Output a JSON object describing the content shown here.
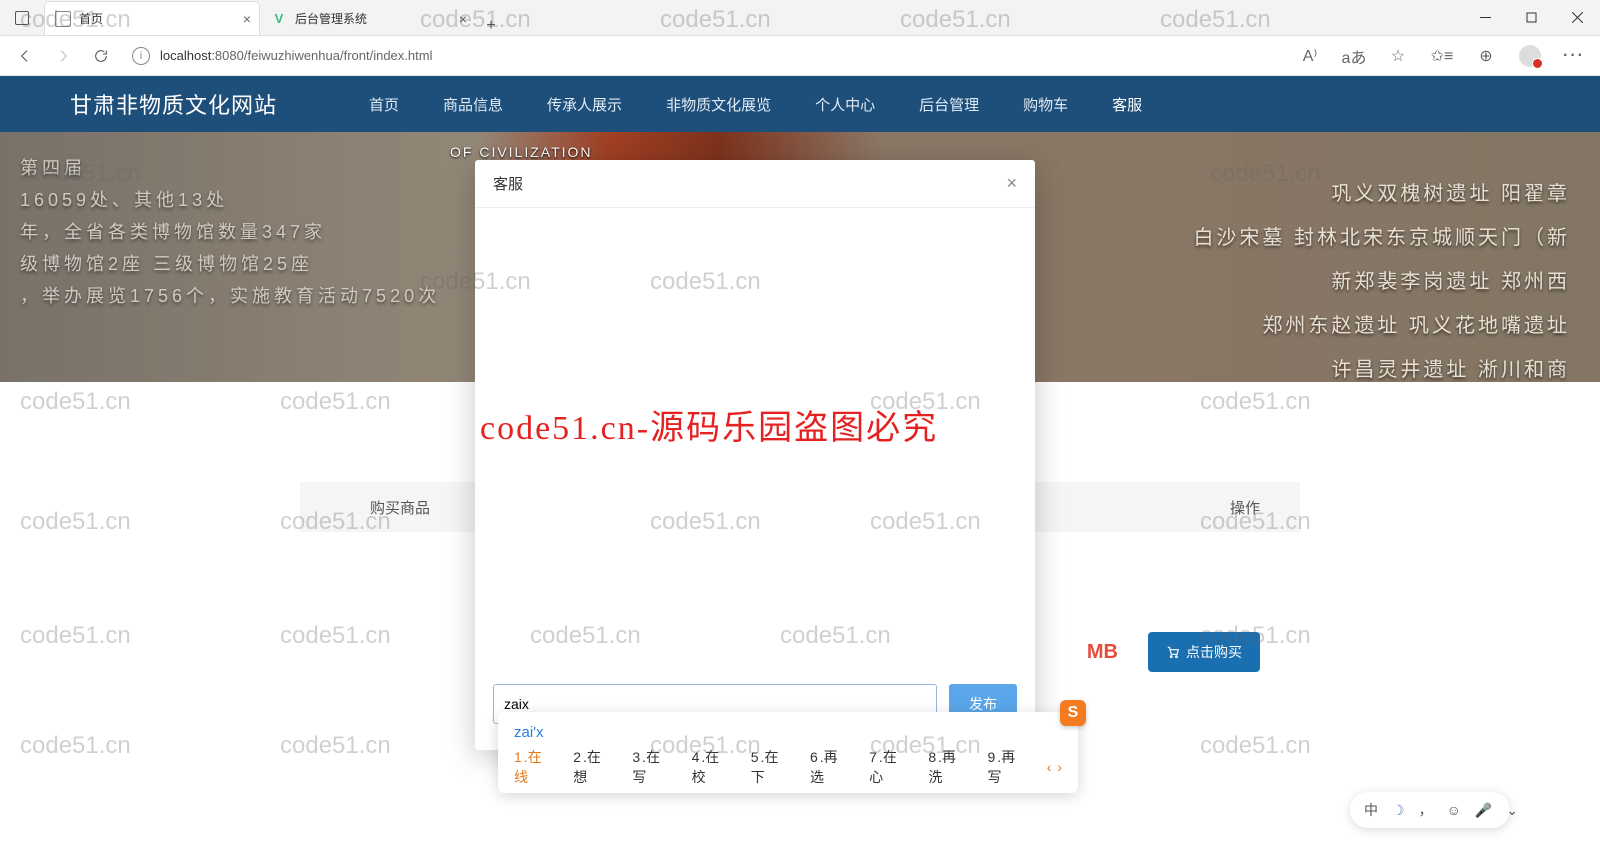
{
  "browser": {
    "tabs": [
      {
        "title": "首页",
        "active": true
      },
      {
        "title": "后台管理系统",
        "active": false
      }
    ],
    "url_host": "localhost",
    "url_port": ":8080",
    "url_path": "/feiwuzhiwenhua/front/index.html"
  },
  "site": {
    "title": "甘肃非物质文化网站",
    "nav": [
      "首页",
      "商品信息",
      "传承人展示",
      "非物质文化展览",
      "个人中心",
      "后台管理",
      "购物车",
      "客服"
    ],
    "active_nav": "客服"
  },
  "hero": {
    "civ": "OF CIVILIZATION",
    "left_lines": "第四届\n16059处、其他13处\n年，全省各类博物馆数量347家\n级博物馆2座 三级博物馆25座\n，举办展览1756个，实施教育活动7520次",
    "right_lines": "巩义双槐树遗址   阳翟章\n白沙宋墓   封林北宋东京城顺天门（新\n新郑裴李岗遗址   郑州西\n郑州东赵遗址   巩义花地嘴遗址\n许昌灵井遗址   淅川和商"
  },
  "table": {
    "col1": "购买商品",
    "col2": "操作",
    "mb": "MB",
    "buy_btn": "点击购买"
  },
  "dialog": {
    "title": "客服",
    "input_value": "zaix",
    "send": "发布"
  },
  "ime": {
    "compose": "zai'x",
    "candidates": [
      {
        "n": "1",
        "w": "在线"
      },
      {
        "n": "2",
        "w": "在想"
      },
      {
        "n": "3",
        "w": "在写"
      },
      {
        "n": "4",
        "w": "在校"
      },
      {
        "n": "5",
        "w": "在下"
      },
      {
        "n": "6",
        "w": "再选"
      },
      {
        "n": "7",
        "w": "在心"
      },
      {
        "n": "8",
        "w": "再洗"
      },
      {
        "n": "9",
        "w": "再写"
      }
    ],
    "logo": "S"
  },
  "ime_float": {
    "mode": "中",
    "comma": "，"
  },
  "watermark": {
    "text": "code51.cn",
    "red": "code51.cn-源码乐园盗图必究"
  }
}
